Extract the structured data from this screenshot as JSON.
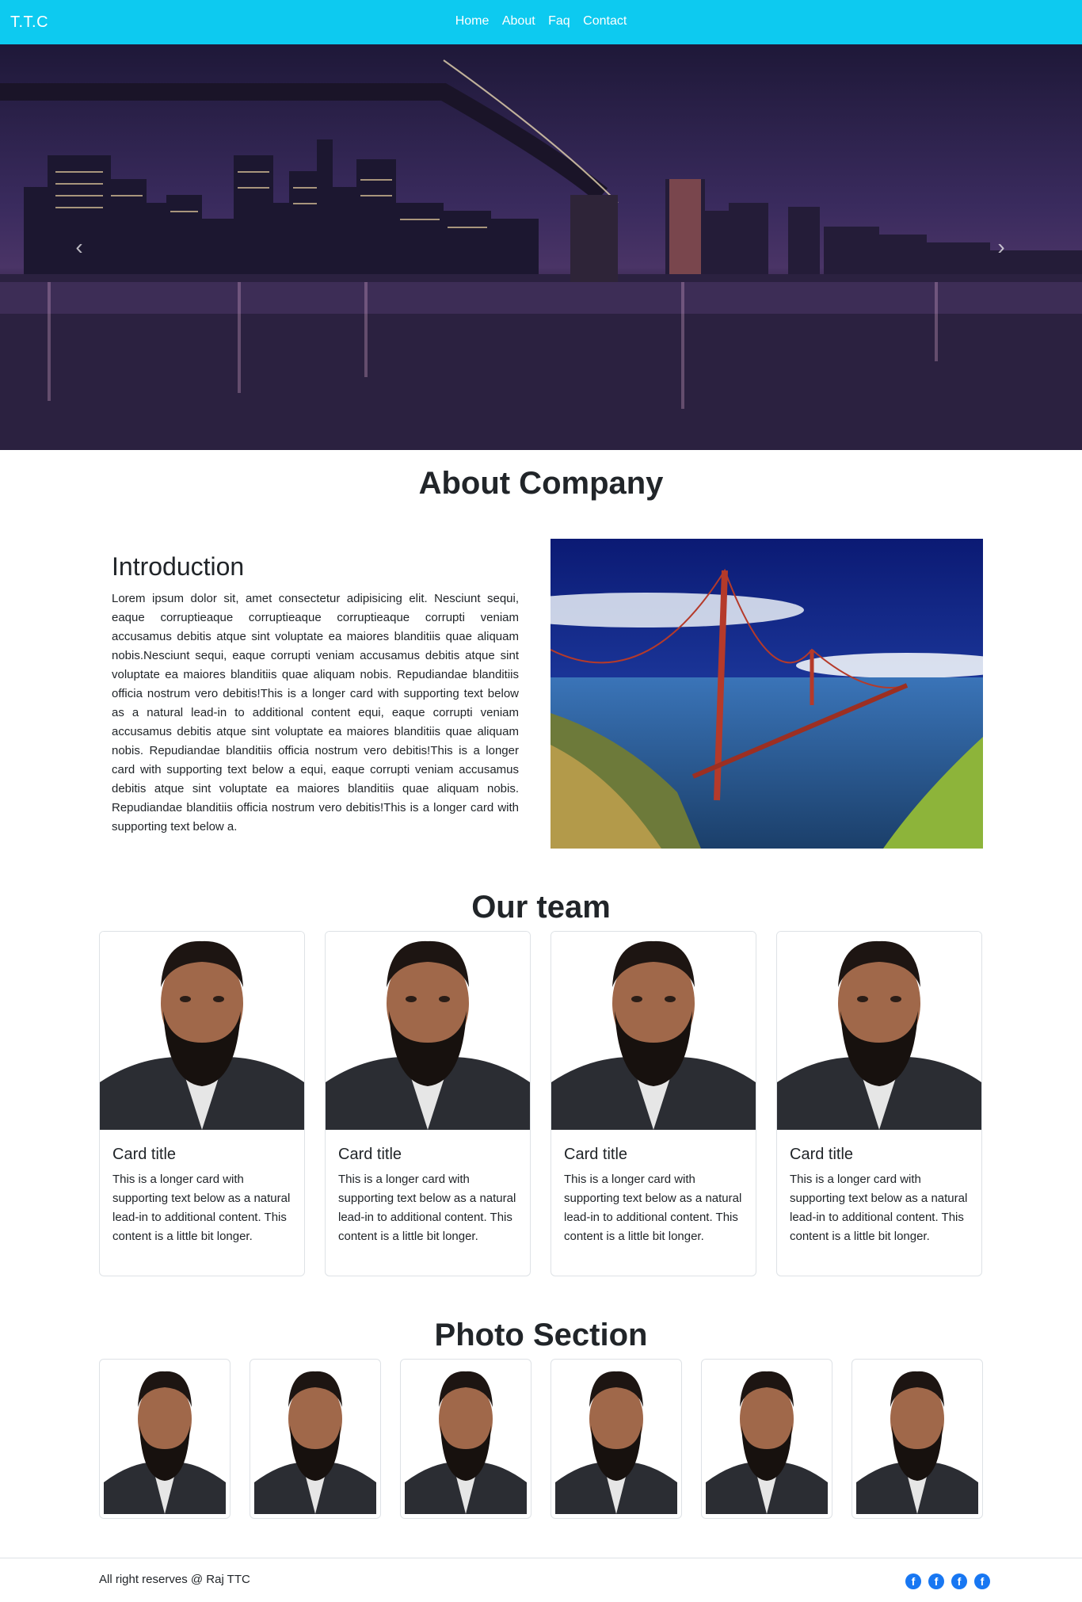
{
  "navbar": {
    "brand": "T.T.C",
    "links": [
      "Home",
      "About",
      "Faq",
      "Contact"
    ]
  },
  "hero": {
    "prev_icon": "chevron-left-icon",
    "next_icon": "chevron-right-icon"
  },
  "about": {
    "heading": "About Company",
    "intro_title": "Introduction",
    "intro_text": "Lorem ipsum dolor sit, amet consectetur adipisicing elit. Nesciunt sequi, eaque corruptieaque corruptieaque corruptieaque corrupti veniam accusamus debitis atque sint voluptate ea maiores blanditiis quae aliquam nobis.Nesciunt sequi, eaque corrupti veniam accusamus debitis atque sint voluptate ea maiores blanditiis quae aliquam nobis. Repudiandae blanditiis officia nostrum vero debitis!This is a longer card with supporting text below as a natural lead-in to additional content equi, eaque corrupti veniam accusamus debitis atque sint voluptate ea maiores blanditiis quae aliquam nobis. Repudiandae blanditiis officia nostrum vero debitis!This is a longer card with supporting text below a equi, eaque corrupti veniam accusamus debitis atque sint voluptate ea maiores blanditiis quae aliquam nobis. Repudiandae blanditiis officia nostrum vero debitis!This is a longer card with supporting text below a."
  },
  "team": {
    "heading": "Our team",
    "cards": [
      {
        "title": "Card title",
        "text": "This is a longer card with supporting text below as a natural lead-in to additional content. This content is a little bit longer."
      },
      {
        "title": "Card title",
        "text": "This is a longer card with supporting text below as a natural lead-in to additional content. This content is a little bit longer."
      },
      {
        "title": "Card title",
        "text": "This is a longer card with supporting text below as a natural lead-in to additional content. This content is a little bit longer."
      },
      {
        "title": "Card title",
        "text": "This is a longer card with supporting text below as a natural lead-in to additional content. This content is a little bit longer."
      }
    ]
  },
  "photos": {
    "heading": "Photo Section",
    "count": 6
  },
  "footer": {
    "text": "All right reserves @ Raj TTC",
    "social_icons": [
      "facebook-icon",
      "facebook-icon",
      "facebook-icon",
      "facebook-icon"
    ]
  },
  "colors": {
    "navbar": "#0dcaf0",
    "social": "#1877f2"
  }
}
